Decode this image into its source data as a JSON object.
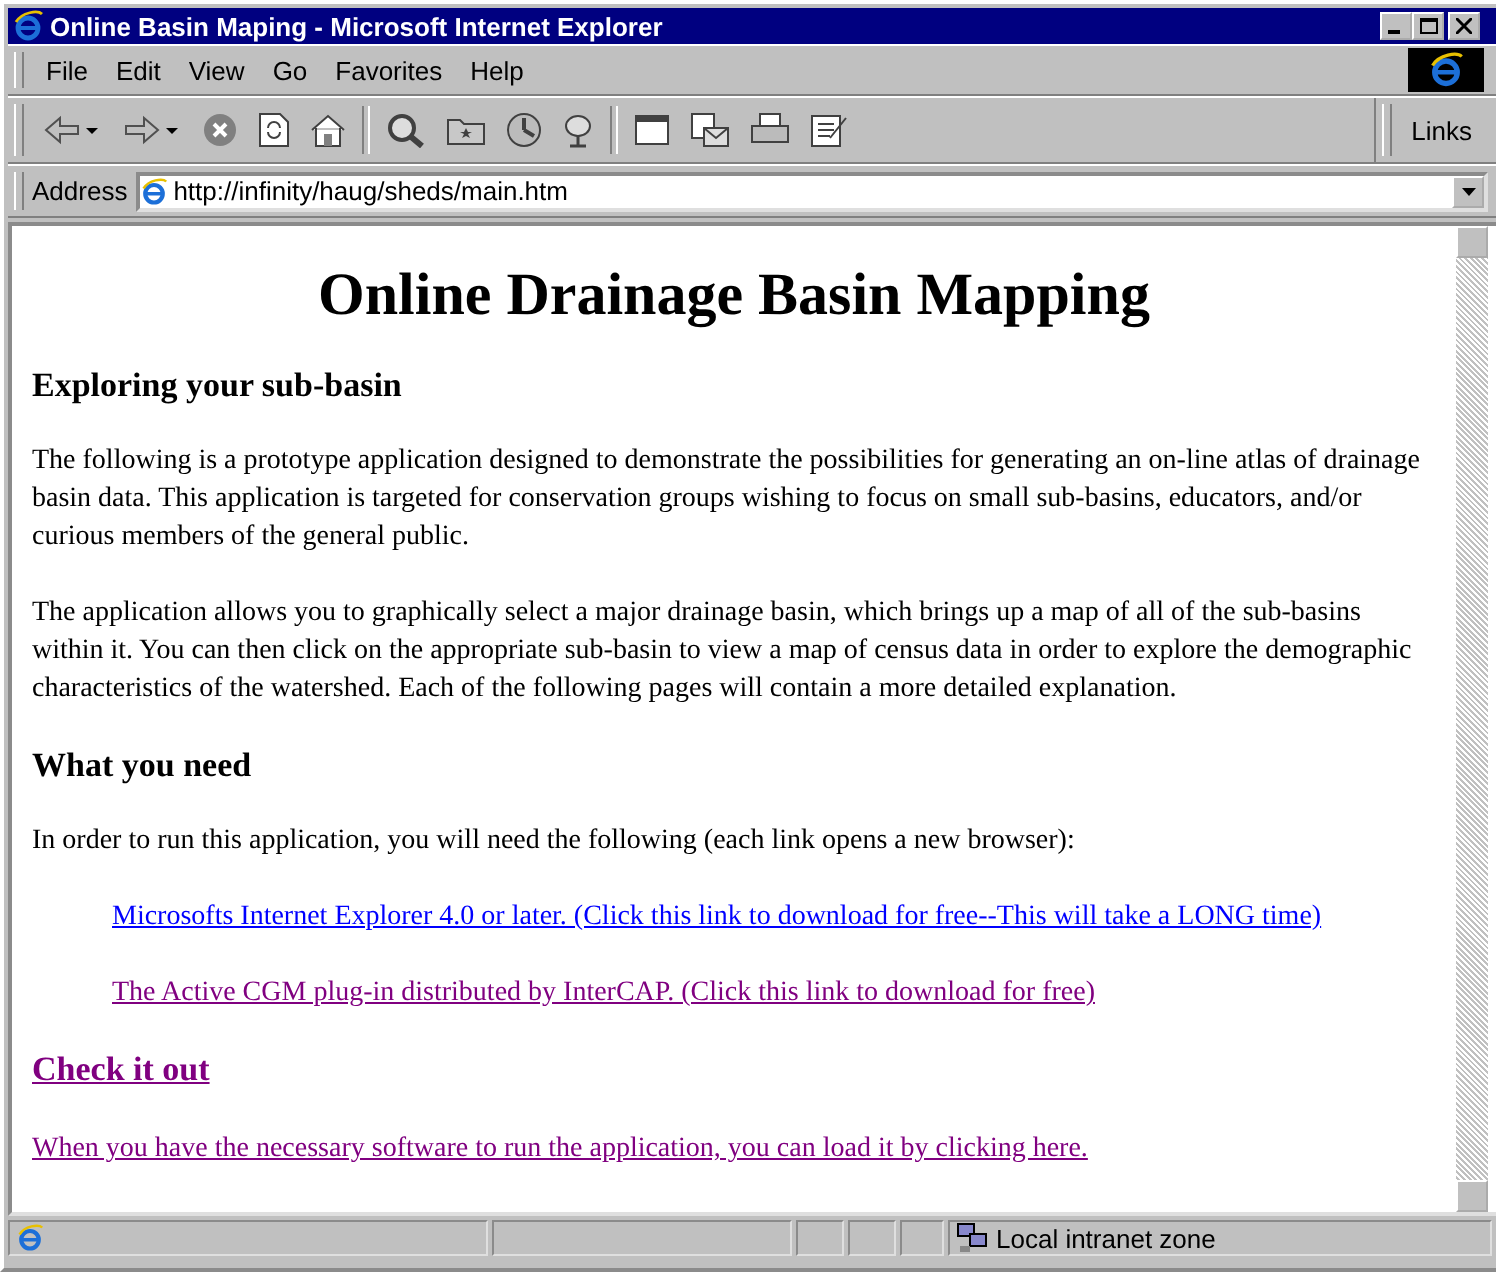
{
  "window": {
    "title": "Online Basin Maping - Microsoft Internet Explorer"
  },
  "menu": [
    {
      "label": "File"
    },
    {
      "label": "Edit"
    },
    {
      "label": "View"
    },
    {
      "label": "Go"
    },
    {
      "label": "Favorites"
    },
    {
      "label": "Help"
    }
  ],
  "links_label": "Links",
  "address": {
    "label": "Address",
    "url": "http://infinity/haug/sheds/main.htm"
  },
  "page": {
    "heading": "Online Drainage Basin Mapping",
    "blocks": [
      {
        "kind": "subheading",
        "text": "Exploring your sub-basin"
      },
      {
        "kind": "paragraph",
        "text": "The following is a prototype application designed to demonstrate the possibilities for generating an on-line atlas of drainage basin data. This application is targeted for conservation groups wishing to focus on small sub-basins, educators, and/or curious members of the general public."
      },
      {
        "kind": "paragraph",
        "text": "The application allows you to graphically select a major drainage basin, which brings up a map of all of the sub-basins within it.  You can then click on the appropriate sub-basin to view a map of census data in order to explore the demographic characteristics of the watershed. Each of the following pages will contain a more detailed explanation."
      },
      {
        "kind": "subheading",
        "text": "What you need"
      },
      {
        "kind": "paragraph",
        "text": "In order to run this application, you will need the following (each link opens a new browser):"
      },
      {
        "kind": "indented_link",
        "text": "Microsofts Internet Explorer 4.0 or later. (Click this link to download for free--This will take a LONG time)",
        "visited": false
      },
      {
        "kind": "indented_link",
        "text": "The Active CGM plug-in distributed by InterCAP. (Click this link to download for free)",
        "visited": true
      },
      {
        "kind": "heading_link",
        "text": "Check it out",
        "visited": true
      },
      {
        "kind": "link",
        "text": "When you have the necessary software to run the application, you can load it by clicking here.",
        "visited": true
      }
    ]
  },
  "status_bar": {
    "zone": "Local intranet zone"
  }
}
